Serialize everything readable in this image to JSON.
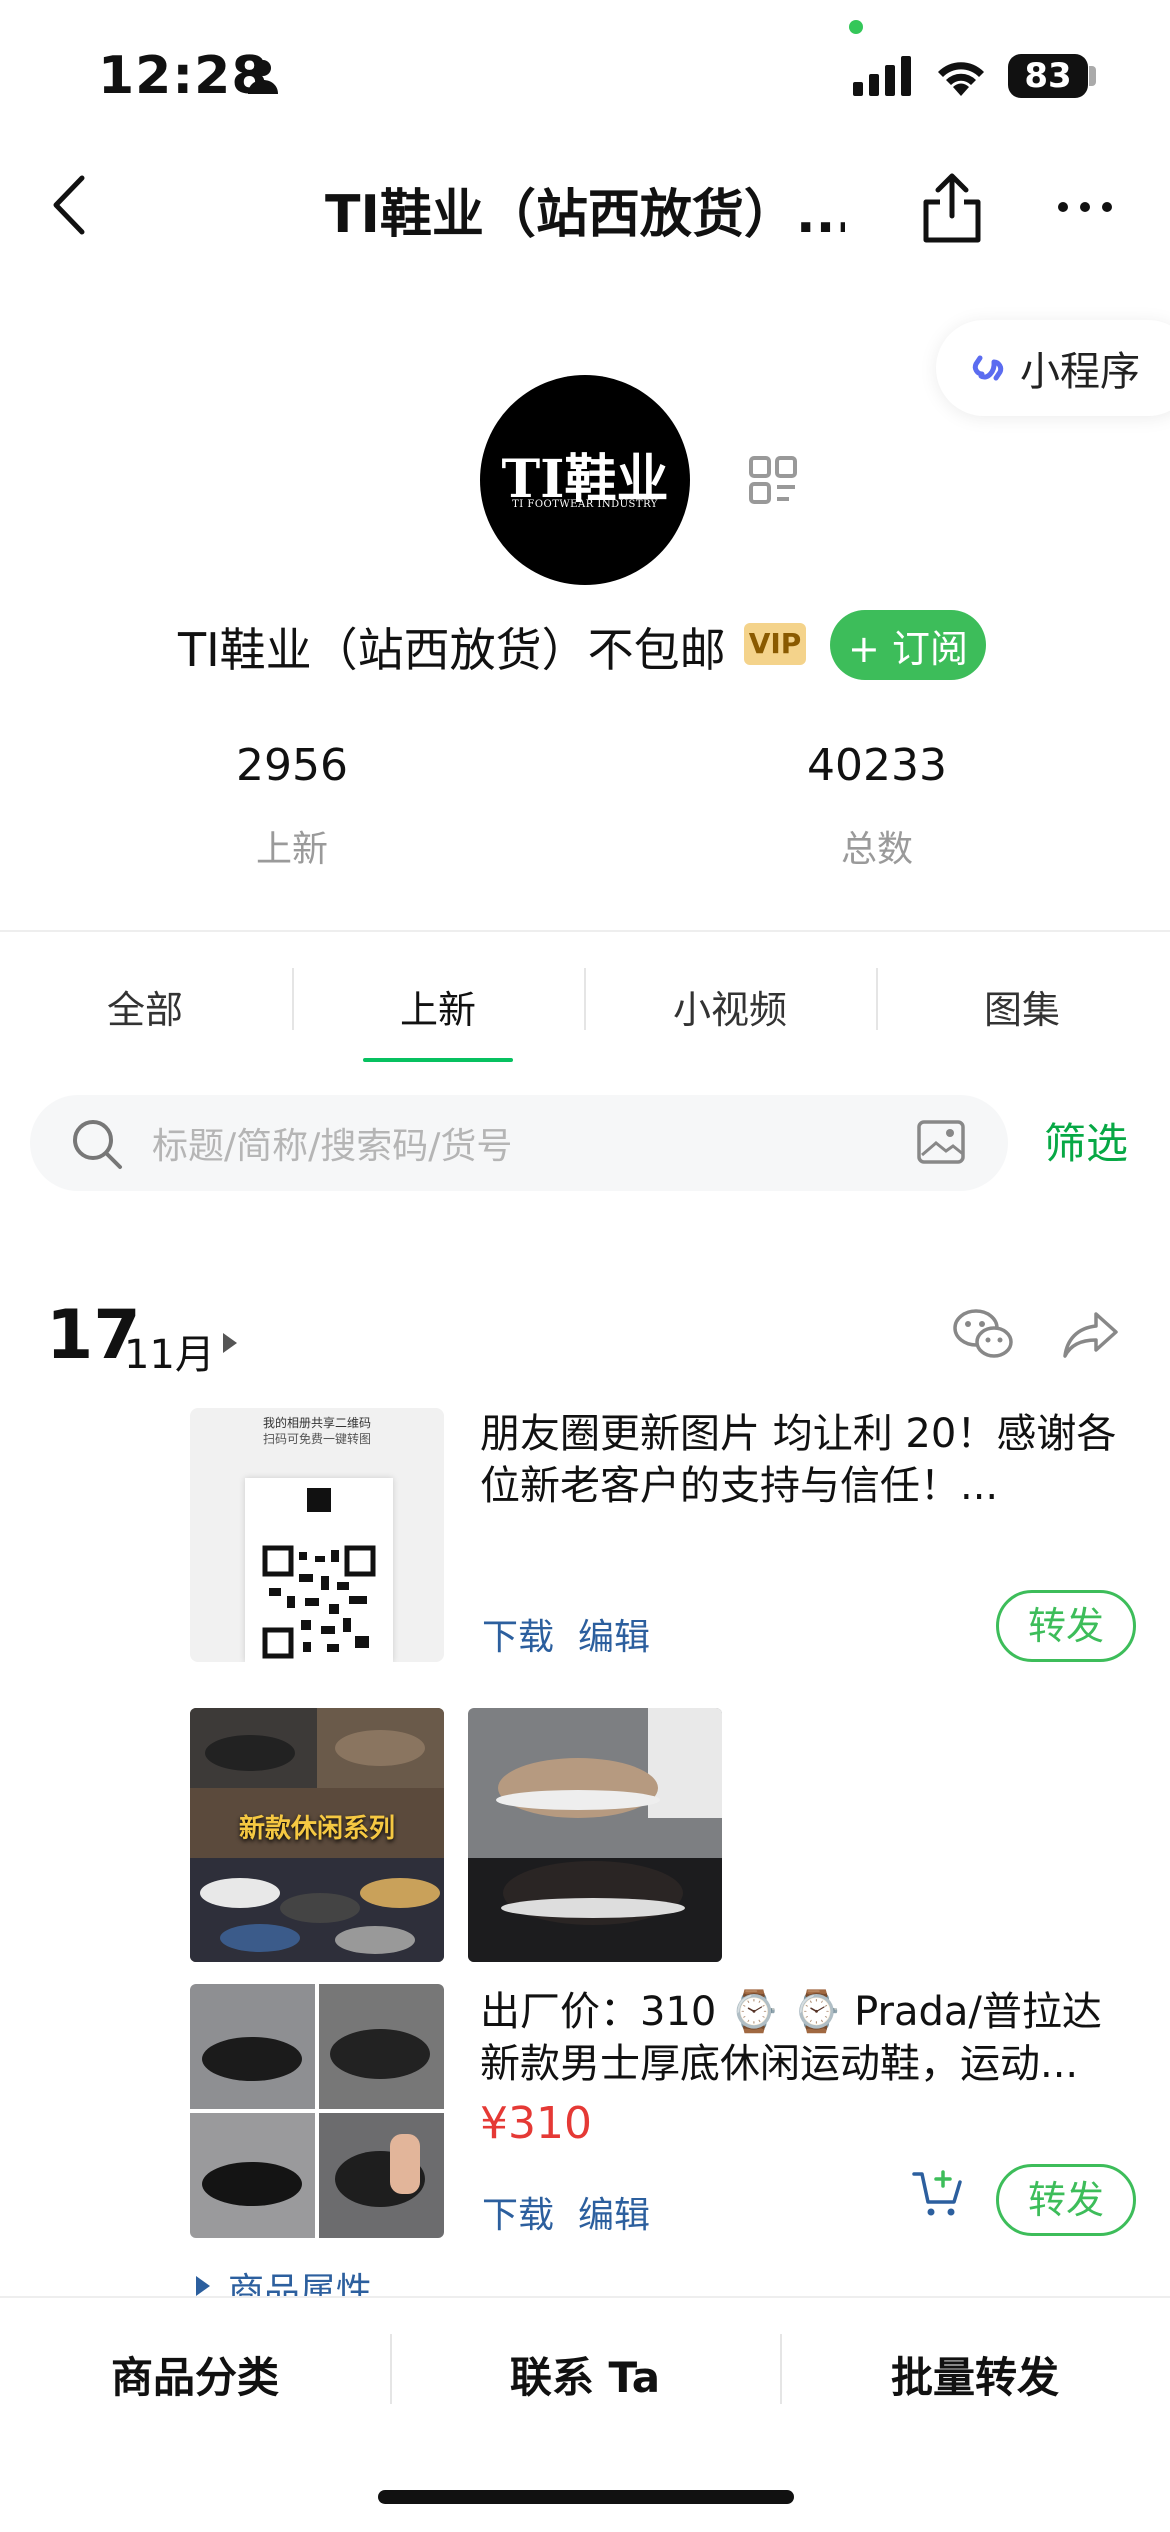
{
  "status": {
    "time": "12:28",
    "battery": "83"
  },
  "nav": {
    "title": "TI鞋业（站西放货）..."
  },
  "mini_program": {
    "label": "小程序"
  },
  "shop": {
    "logo_text": "TI鞋业",
    "logo_sub": "TI FOOTWEAR INDUSTRY",
    "name": "TI鞋业（站西放货）不包邮",
    "vip": "VIP",
    "subscribe": "+ 订阅"
  },
  "stats": [
    {
      "value": "2956",
      "label": "上新"
    },
    {
      "value": "40233",
      "label": "总数"
    }
  ],
  "tabs": [
    {
      "label": "全部"
    },
    {
      "label": "上新",
      "active": true
    },
    {
      "label": "小视频"
    },
    {
      "label": "图集"
    }
  ],
  "search": {
    "placeholder": "标题/简称/搜索码/货号",
    "filter": "筛选"
  },
  "date": {
    "day": "17",
    "month": "11月"
  },
  "posts": [
    {
      "text": "朋友圈更新图片 均让利 20！感谢各位新老客户的支持与信任！...",
      "thumb_caption1": "我的相册共享二维码",
      "thumb_caption2": "扫码可免费一键转图",
      "download": "下载",
      "edit": "编辑",
      "forward": "转发"
    },
    {
      "photo_caption": "新款休闲系列",
      "text": "出厂价：310 ⌚ ⌚ Prada/普拉达新款男士厚底休闲运动鞋，运动...",
      "price": "¥310",
      "download": "下载",
      "edit": "编辑",
      "forward": "转发",
      "attributes": "商品属性"
    }
  ],
  "bottom": [
    "商品分类",
    "联系 Ta",
    "批量转发"
  ],
  "colors": {
    "accent": "#07c160",
    "price": "#e53935",
    "link": "#2c5f9e"
  }
}
